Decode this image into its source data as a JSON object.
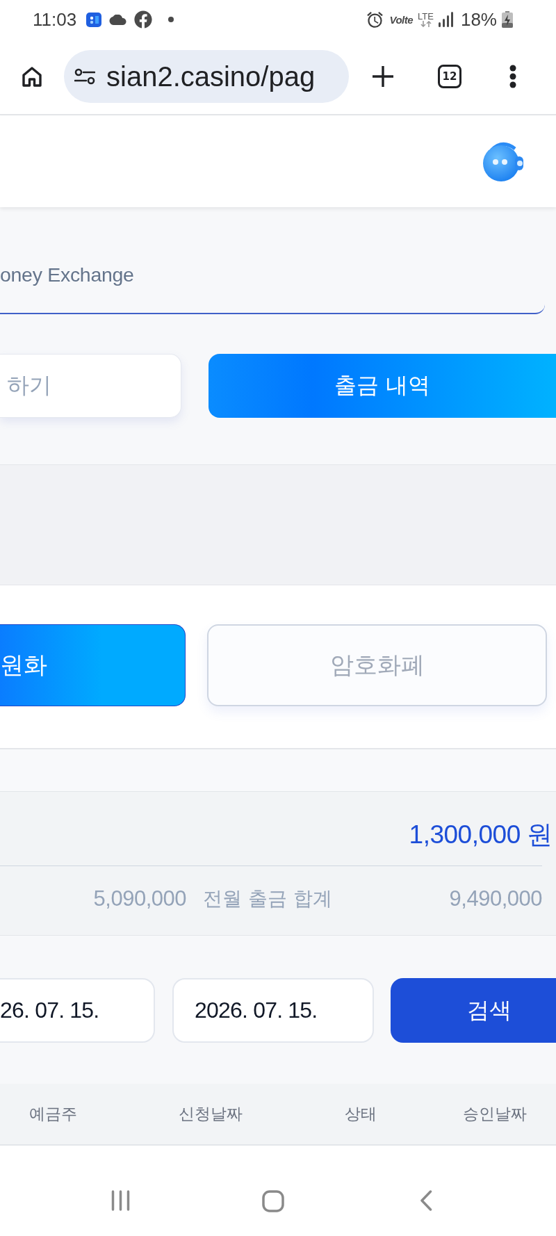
{
  "status_bar": {
    "time": "11:03",
    "network_label": "Volte",
    "network_type": "LTE",
    "battery": "18%"
  },
  "browser": {
    "url": "sian2.casino/pag",
    "tab_count": "12"
  },
  "page_title": "oney Exchange",
  "tabs": [
    {
      "label": "하기",
      "selected": false
    },
    {
      "label": "출금 내역",
      "selected": true
    }
  ],
  "currency_options": [
    {
      "label": "원화",
      "selected": true
    },
    {
      "label": "암호화폐",
      "selected": false
    }
  ],
  "summary": {
    "amount": "1,300,000 원",
    "value_1": "5,090,000",
    "previous_month_label": "전월 출금 합계",
    "previous_month_value": "9,490,000"
  },
  "date_search": {
    "start_date": "26. 07. 15.",
    "end_date": "2026. 07. 15.",
    "button": "검색"
  },
  "table": {
    "columns": [
      "예금주",
      "신청날짜",
      "상태",
      "승인날짜"
    ]
  }
}
